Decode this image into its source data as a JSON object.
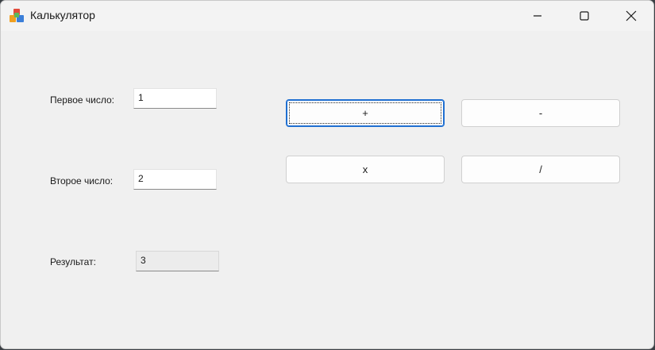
{
  "window": {
    "title": "Калькулятор",
    "icons": {
      "app": "calculator-app-icon",
      "minimize": "minimize-icon",
      "maximize": "maximize-icon",
      "close": "close-icon"
    }
  },
  "form": {
    "first_label": "Первое число:",
    "first_value": "1",
    "second_label": "Второе число:",
    "second_value": "2",
    "result_label": "Результат:",
    "result_value": "3"
  },
  "buttons": {
    "add": "+",
    "subtract": "-",
    "multiply": "x",
    "divide": "/"
  },
  "colors": {
    "focus_accent": "#1f6fd1",
    "window_bg": "#f0f0f0"
  }
}
